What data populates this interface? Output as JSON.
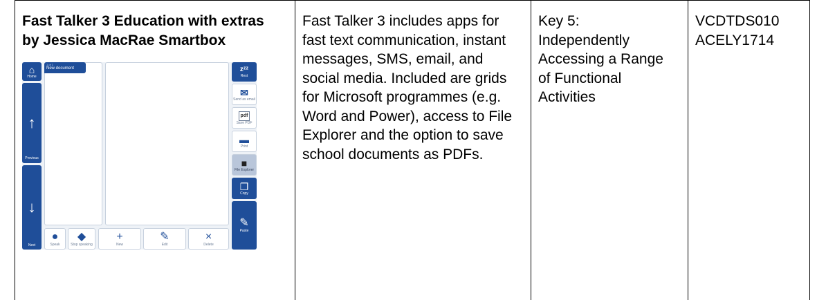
{
  "row": {
    "title": "Fast Talker 3 Education with extras by Jessica MacRae Smartbox",
    "description": "Fast Talker 3 includes apps for fast text communication, instant messages, SMS, email, and social media. Included are grids for Microsoft programmes (e.g. Word and Power), access to File Explorer and the option to save school documents as PDFs.",
    "key_area": "Key 5: Independently Accessing a Range of Functional Activities",
    "codes": [
      "VCDTDS010",
      "ACELY1714"
    ]
  },
  "screenshot": {
    "left_buttons": [
      {
        "icon": "home-icon",
        "label": "Home"
      },
      {
        "icon": "arrow-up-icon",
        "label": "Previous"
      },
      {
        "icon": "arrow-down-icon",
        "label": "Next"
      }
    ],
    "document_tab": {
      "small": "1 of 1",
      "label": "New document"
    },
    "right_buttons": [
      {
        "icon": "sleep-icon",
        "label": "Rest"
      },
      {
        "icon": "mail-icon",
        "label": "Send as email"
      },
      {
        "icon": "pdf-icon",
        "label": "Save PDF"
      },
      {
        "icon": "printer-icon",
        "label": "Print"
      },
      {
        "icon": "folder-icon",
        "label": "File Explorer"
      },
      {
        "icon": "copy-icon",
        "label": "Copy"
      },
      {
        "icon": "paste-icon",
        "label": "Paste"
      }
    ],
    "bottom_buttons": [
      {
        "icon": "speak-icon",
        "label": "Speak"
      },
      {
        "icon": "stop-speaking-icon",
        "label": "Stop speaking"
      },
      {
        "icon": "plus-icon",
        "label": "New"
      },
      {
        "icon": "pencil-icon",
        "label": "Edit"
      },
      {
        "icon": "close-icon",
        "label": "Delete"
      }
    ],
    "colors": {
      "accent": "#1f4e99",
      "background": "#eef2f7"
    }
  }
}
